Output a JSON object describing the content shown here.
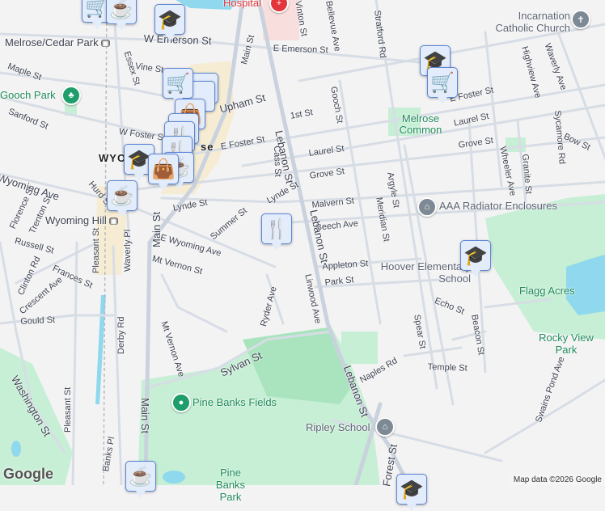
{
  "streets": [
    "W Emerson St",
    "E Emerson St",
    "Vine St",
    "Essex St",
    "Maple St",
    "Sanford St",
    "W Foster St",
    "E Foster St",
    "Upham St",
    "1st St",
    "Main St",
    "Lebanon St",
    "Cass St",
    "Laurel St",
    "Grove St",
    "Lynde St",
    "Lynde St",
    "Malvern St",
    "Beech Ave",
    "Summer St",
    "E Wyoming Ave",
    "Wyoming Ave",
    "Hurd St",
    "Florence St",
    "Trenton St",
    "Russell St",
    "Clinton Rd",
    "Frances St",
    "Crescent Ave",
    "Mt Vernon St",
    "Pleasant St",
    "Waverly Pl",
    "Gould St",
    "Derby Rd",
    "Mt Vernon Ave",
    "Ryder Ave",
    "Linwood Ave",
    "Sylvan St",
    "Washington St",
    "Pleasant St",
    "Banks Pl",
    "Main St",
    "Lebanon St",
    "Naples Rd",
    "Forest St",
    "Appleton St",
    "Park St",
    "Echo St",
    "Spear St",
    "Beacon St",
    "Temple St",
    "Swains Pond Ave",
    "Gooch St",
    "Stratford Rd",
    "Argyle St",
    "Meridian St",
    "Wheeler Ave",
    "Granite St",
    "Highview Ave",
    "Waverly Ave",
    "Sycamore Rd",
    "Bow St",
    "E Foster St",
    "Laurel St",
    "Grove St",
    "Bellevue Ave",
    "Vinton St",
    "Lebanon St",
    "Main St"
  ],
  "places": {
    "melrose_cedar_park": "Melrose/Cedar Park",
    "wyoming_hill": "Wyoming Hill",
    "gooch_park": "Gooch Park",
    "melrose_common": "Melrose Common",
    "incarnation": "Incarnation Catholic Church",
    "aaa": "AAA Radiator Enclosures",
    "hoover": "Hoover Elementary School",
    "flagg_acres": "Flagg Acres",
    "rocky_view": "Rocky View Park",
    "ripley": "Ripley School",
    "pine_banks_fields": "Pine Banks Fields",
    "pine_banks_park": "Pine Banks Park",
    "hospital": "Hospital",
    "wyo": "WYO",
    "melrose_frag": "se"
  },
  "markers": [
    "shopping-cart",
    "coffee",
    "graduation-cap",
    "shopping-cart",
    "graduation-cap",
    "shopping-bag",
    "coffee",
    "restaurant",
    "graduation-cap",
    "shopping-cart",
    "graduation-cap",
    "coffee",
    "graduation-cap"
  ],
  "footer": {
    "logo": "Google",
    "attribution": "Map data ©2026 Google"
  },
  "colors": {
    "road": "#d7dde5",
    "park": "#c6efd5",
    "water": "#8fd8ee",
    "marker": "#e3ecfb",
    "marker_icon": "#0f3e68"
  }
}
